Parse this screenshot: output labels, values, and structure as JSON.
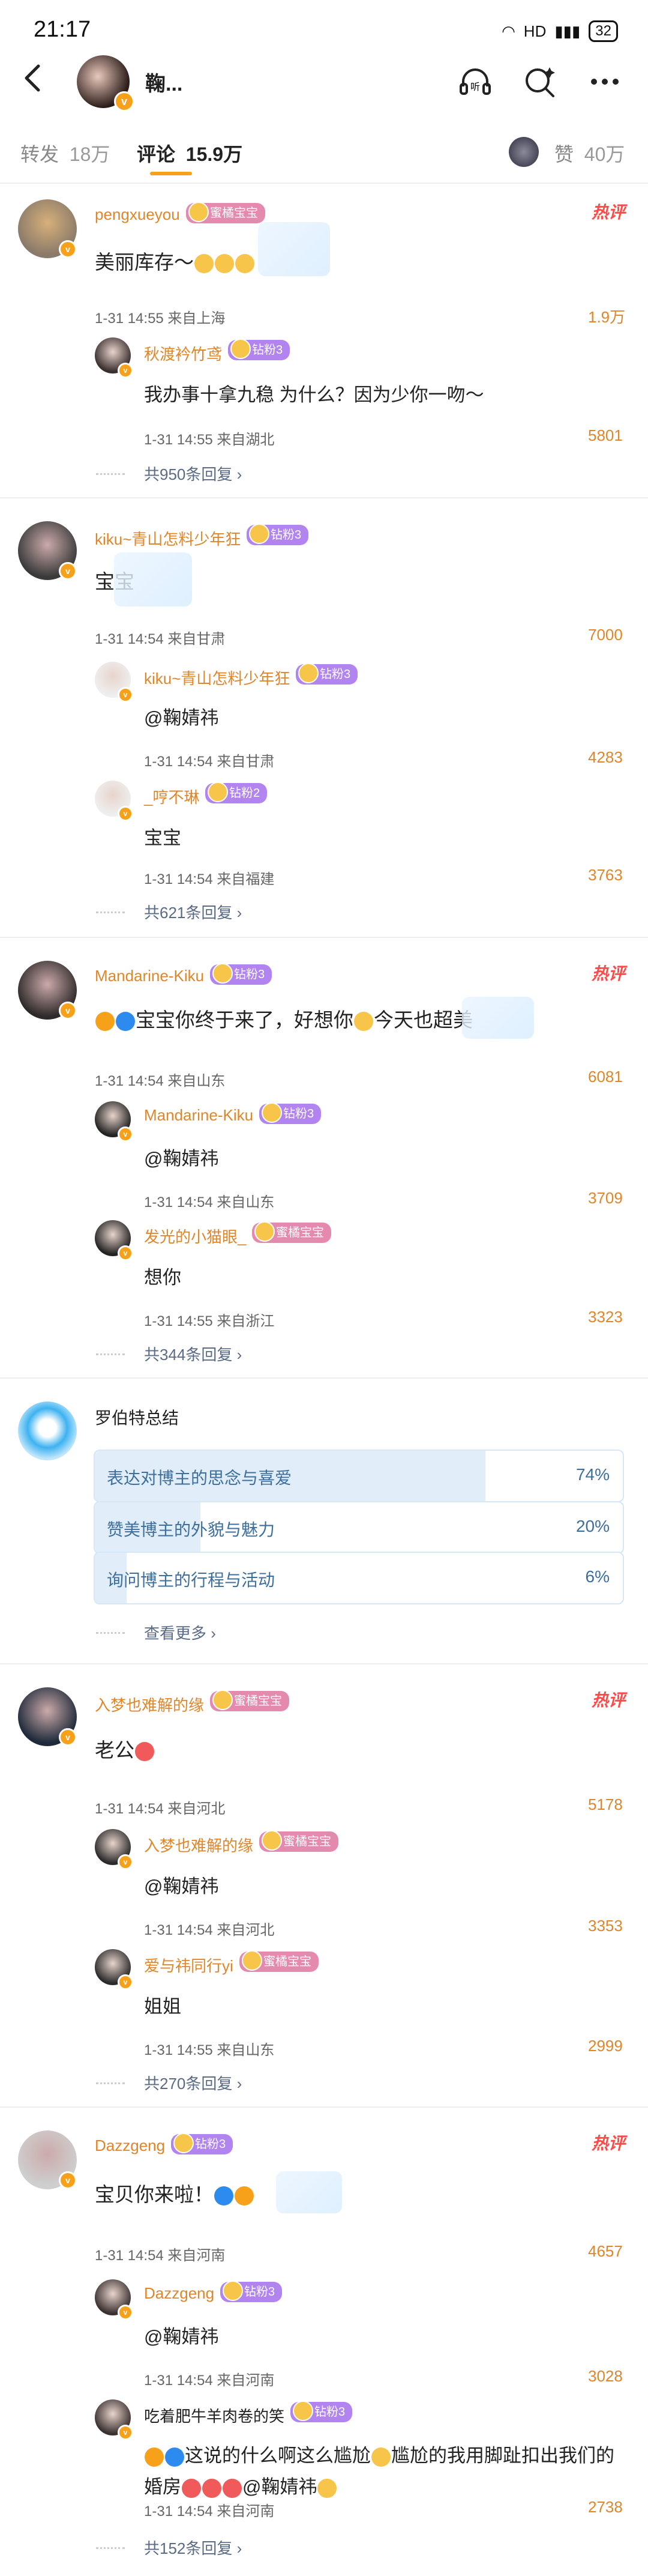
{
  "status": {
    "time": "21:17",
    "battery": "32"
  },
  "header": {
    "name": "鞠..."
  },
  "tabs": [
    {
      "label": "转发",
      "count": "18万"
    },
    {
      "label": "评论",
      "count": "15.9万"
    },
    {
      "label": "赞",
      "count": "40万"
    }
  ],
  "threads": [
    {
      "hot": "热评",
      "user": "pengxueyou",
      "badge": "蜜橘宝宝",
      "text": "美丽库存～",
      "meta": "1-31  14:55  来自上海",
      "likes": "1.9万",
      "replies": [
        {
          "user": "秋渡衿竹鸢",
          "badge": "钻粉3",
          "text": "我办事十拿九稳  为什么？因为少你一吻～",
          "meta": "1-31  14:55  来自湖北",
          "likes": "5801"
        }
      ],
      "more": "共950条回复"
    },
    {
      "hot": "",
      "user": "kiku~青山怎料少年狂",
      "badge": "钻粉3",
      "text": "宝宝",
      "meta": "1-31  14:54  来自甘肃",
      "likes": "7000",
      "replies": [
        {
          "user": "kiku~青山怎料少年狂",
          "badge": "钻粉3",
          "text": "@鞠婧祎",
          "meta": "1-31  14:54  来自甘肃",
          "likes": "4283"
        },
        {
          "user": "_哼不琳",
          "badge": "钻粉2",
          "text": "宝宝",
          "meta": "1-31  14:54  来自福建",
          "likes": "3763"
        }
      ],
      "more": "共621条回复"
    },
    {
      "hot": "热评",
      "user": "Mandarine-Kiku",
      "badge": "钻粉3",
      "text": "宝宝你终于来了，好想你",
      "text_tail": "今天也超美",
      "meta": "1-31  14:54  来自山东",
      "likes": "6081",
      "replies": [
        {
          "user": "Mandarine-Kiku",
          "badge": "钻粉3",
          "text": "@鞠婧祎",
          "meta": "1-31  14:54  来自山东",
          "likes": "3709"
        },
        {
          "user": "发光的小猫眼_",
          "badge": "蜜橘宝宝",
          "text": "想你",
          "meta": "1-31  14:55  来自浙江",
          "likes": "3323"
        }
      ],
      "more": "共344条回复"
    },
    {
      "hot": "热评",
      "user": "入梦也难解的缘",
      "badge": "蜜橘宝宝",
      "text": "老公",
      "meta": "1-31  14:54  来自河北",
      "likes": "5178",
      "replies": [
        {
          "user": "入梦也难解的缘",
          "badge": "蜜橘宝宝",
          "text": "@鞠婧祎",
          "meta": "1-31  14:54  来自河北",
          "likes": "3353"
        },
        {
          "user": "爱与祎同行yi",
          "badge": "蜜橘宝宝",
          "text": "姐姐",
          "meta": "1-31  14:55  来自山东",
          "likes": "2999"
        }
      ],
      "more": "共270条回复"
    },
    {
      "hot": "热评",
      "user": "Dazzgeng",
      "badge": "钻粉3",
      "text": "宝贝你来啦！",
      "meta": "1-31  14:54  来自河南",
      "likes": "4657",
      "replies": [
        {
          "user": "Dazzgeng",
          "badge": "钻粉3",
          "text": "@鞠婧祎",
          "meta": "1-31  14:54  来自河南",
          "likes": "3028"
        },
        {
          "user": "吃着肥牛羊肉卷的笑",
          "badge": "钻粉3",
          "text": "这说的什么啊这么尴尬",
          "text2": "尴尬的我用脚趾扣出我们的",
          "text3": "婚房",
          "text3_tail": "@鞠婧祎",
          "meta": "1-31  14:54  来自河南",
          "likes": "2738"
        }
      ],
      "more": "共152条回复"
    }
  ],
  "summary": {
    "title": "罗伯特总结",
    "items": [
      {
        "label": "表达对博主的思念与喜爱",
        "pct": "74%",
        "value": 0.74
      },
      {
        "label": "赞美博主的外貌与魅力",
        "pct": "20%",
        "value": 0.2
      },
      {
        "label": "询问博主的行程与活动",
        "pct": "6%",
        "value": 0.06
      }
    ],
    "more": "查看更多"
  },
  "colors": {
    "accent": "#f7a11a",
    "name": "#e0862a",
    "hot": "#ff4a4a",
    "link": "#5a6b86"
  }
}
